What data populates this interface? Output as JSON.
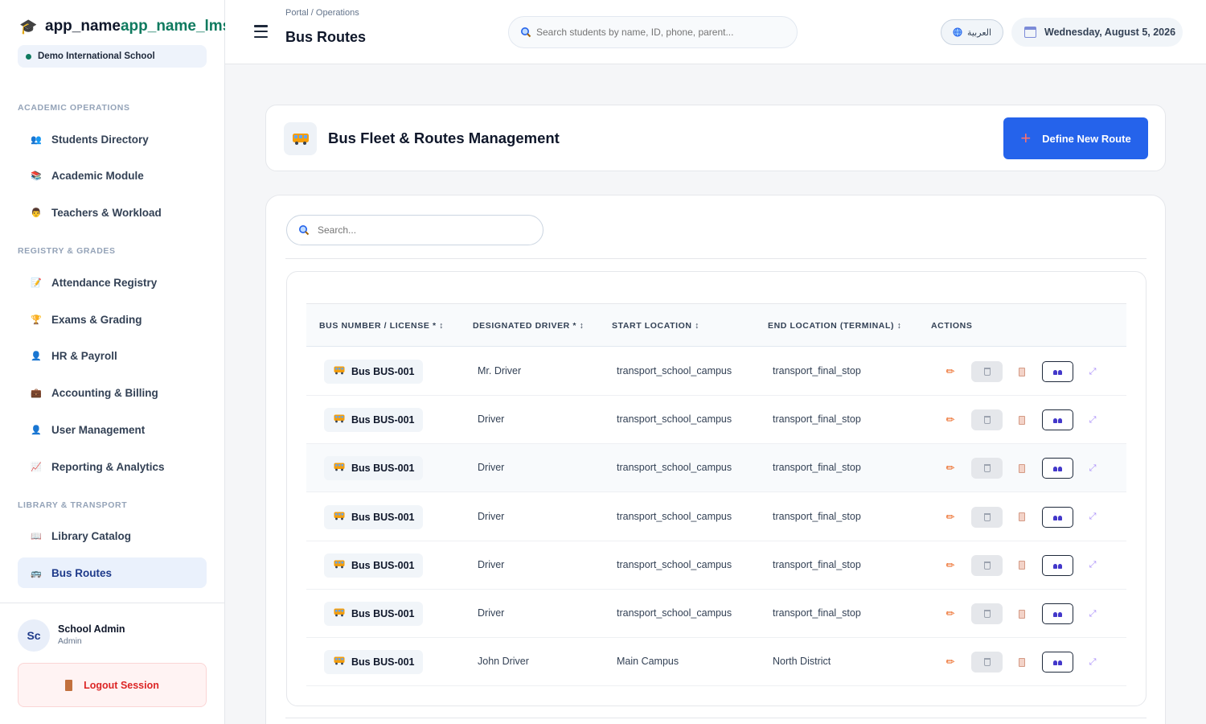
{
  "brand": {
    "part1": "app_name",
    "part2": "app_name_lms"
  },
  "school": "Demo International School",
  "sidebar": {
    "sections": [
      {
        "title": "ACADEMIC OPERATIONS"
      },
      {
        "title": "REGISTRY & GRADES"
      },
      {
        "title": "LIBRARY & TRANSPORT"
      }
    ],
    "items": [
      {
        "label": "Students Directory",
        "icon": "users-icon"
      },
      {
        "label": "Academic Module",
        "icon": "books-icon"
      },
      {
        "label": "Teachers & Workload",
        "icon": "teacher-icon"
      },
      {
        "label": "Attendance Registry",
        "icon": "memo-icon"
      },
      {
        "label": "Exams & Grading",
        "icon": "trophy-icon"
      },
      {
        "label": "HR & Payroll",
        "icon": "person-icon"
      },
      {
        "label": "Accounting & Billing",
        "icon": "briefcase-icon"
      },
      {
        "label": "User Management",
        "icon": "user-icon"
      },
      {
        "label": "Reporting & Analytics",
        "icon": "chart-icon"
      },
      {
        "label": "Library Catalog",
        "icon": "book-icon"
      },
      {
        "label": "Bus Routes",
        "icon": "bus-icon",
        "active": true
      }
    ]
  },
  "user": {
    "initials": "Sc",
    "name": "School Admin",
    "role": "Admin",
    "logout": "Logout Session"
  },
  "topbar": {
    "breadcrumb": "Portal / Operations",
    "title": "Bus Routes",
    "search_placeholder": "Search students by name, ID, phone, parent...",
    "language": "العربية",
    "date": "Wednesday, August 5, 2026"
  },
  "header": {
    "title": "Bus Fleet & Routes Management",
    "button": "Define New Route"
  },
  "list": {
    "search_placeholder": "Search...",
    "columns": [
      "BUS NUMBER / LICENSE * ↕",
      "DESIGNATED DRIVER * ↕",
      "START LOCATION ↕",
      "END LOCATION (TERMINAL) ↕",
      "ACTIONS"
    ],
    "rows": [
      {
        "bus": "Bus BUS-001",
        "driver": "Mr. Driver",
        "start": "transport_school_campus",
        "end": "transport_final_stop"
      },
      {
        "bus": "Bus BUS-001",
        "driver": "Driver",
        "start": "transport_school_campus",
        "end": "transport_final_stop"
      },
      {
        "bus": "Bus BUS-001",
        "driver": "Driver",
        "start": "transport_school_campus",
        "end": "transport_final_stop"
      },
      {
        "bus": "Bus BUS-001",
        "driver": "Driver",
        "start": "transport_school_campus",
        "end": "transport_final_stop"
      },
      {
        "bus": "Bus BUS-001",
        "driver": "Driver",
        "start": "transport_school_campus",
        "end": "transport_final_stop"
      },
      {
        "bus": "Bus BUS-001",
        "driver": "Driver",
        "start": "transport_school_campus",
        "end": "transport_final_stop"
      },
      {
        "bus": "Bus BUS-001",
        "driver": "John Driver",
        "start": "Main Campus",
        "end": "North District"
      }
    ]
  },
  "colors": {
    "primary": "#2563eb",
    "brand_accent": "#0f7a5f",
    "danger": "#dc2626",
    "edit": "#ea580c"
  }
}
